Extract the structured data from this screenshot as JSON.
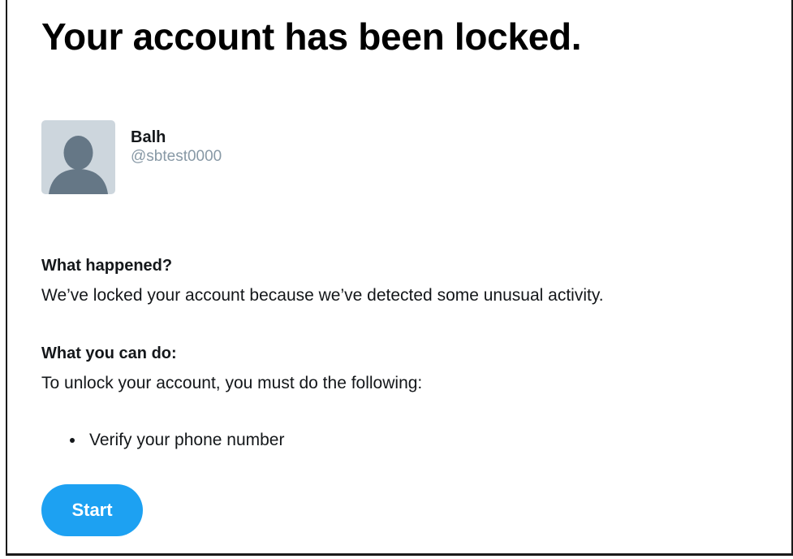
{
  "page": {
    "title": "Your account has been locked."
  },
  "profile": {
    "display_name": "Balh",
    "handle": "@sbtest0000",
    "avatar_icon": "default-profile-silhouette"
  },
  "what_happened": {
    "heading": "What happened?",
    "text": "We’ve locked your account because we’ve detected some unusual activity."
  },
  "what_you_can_do": {
    "heading": "What you can do:",
    "text": "To unlock your account, you must do the following:",
    "steps": [
      "Verify your phone number"
    ]
  },
  "actions": {
    "start_label": "Start"
  },
  "colors": {
    "accent": "#1da1f2",
    "avatar_bg": "#cdd6dd",
    "avatar_figure": "#657786",
    "handle_text": "#8899a6"
  }
}
